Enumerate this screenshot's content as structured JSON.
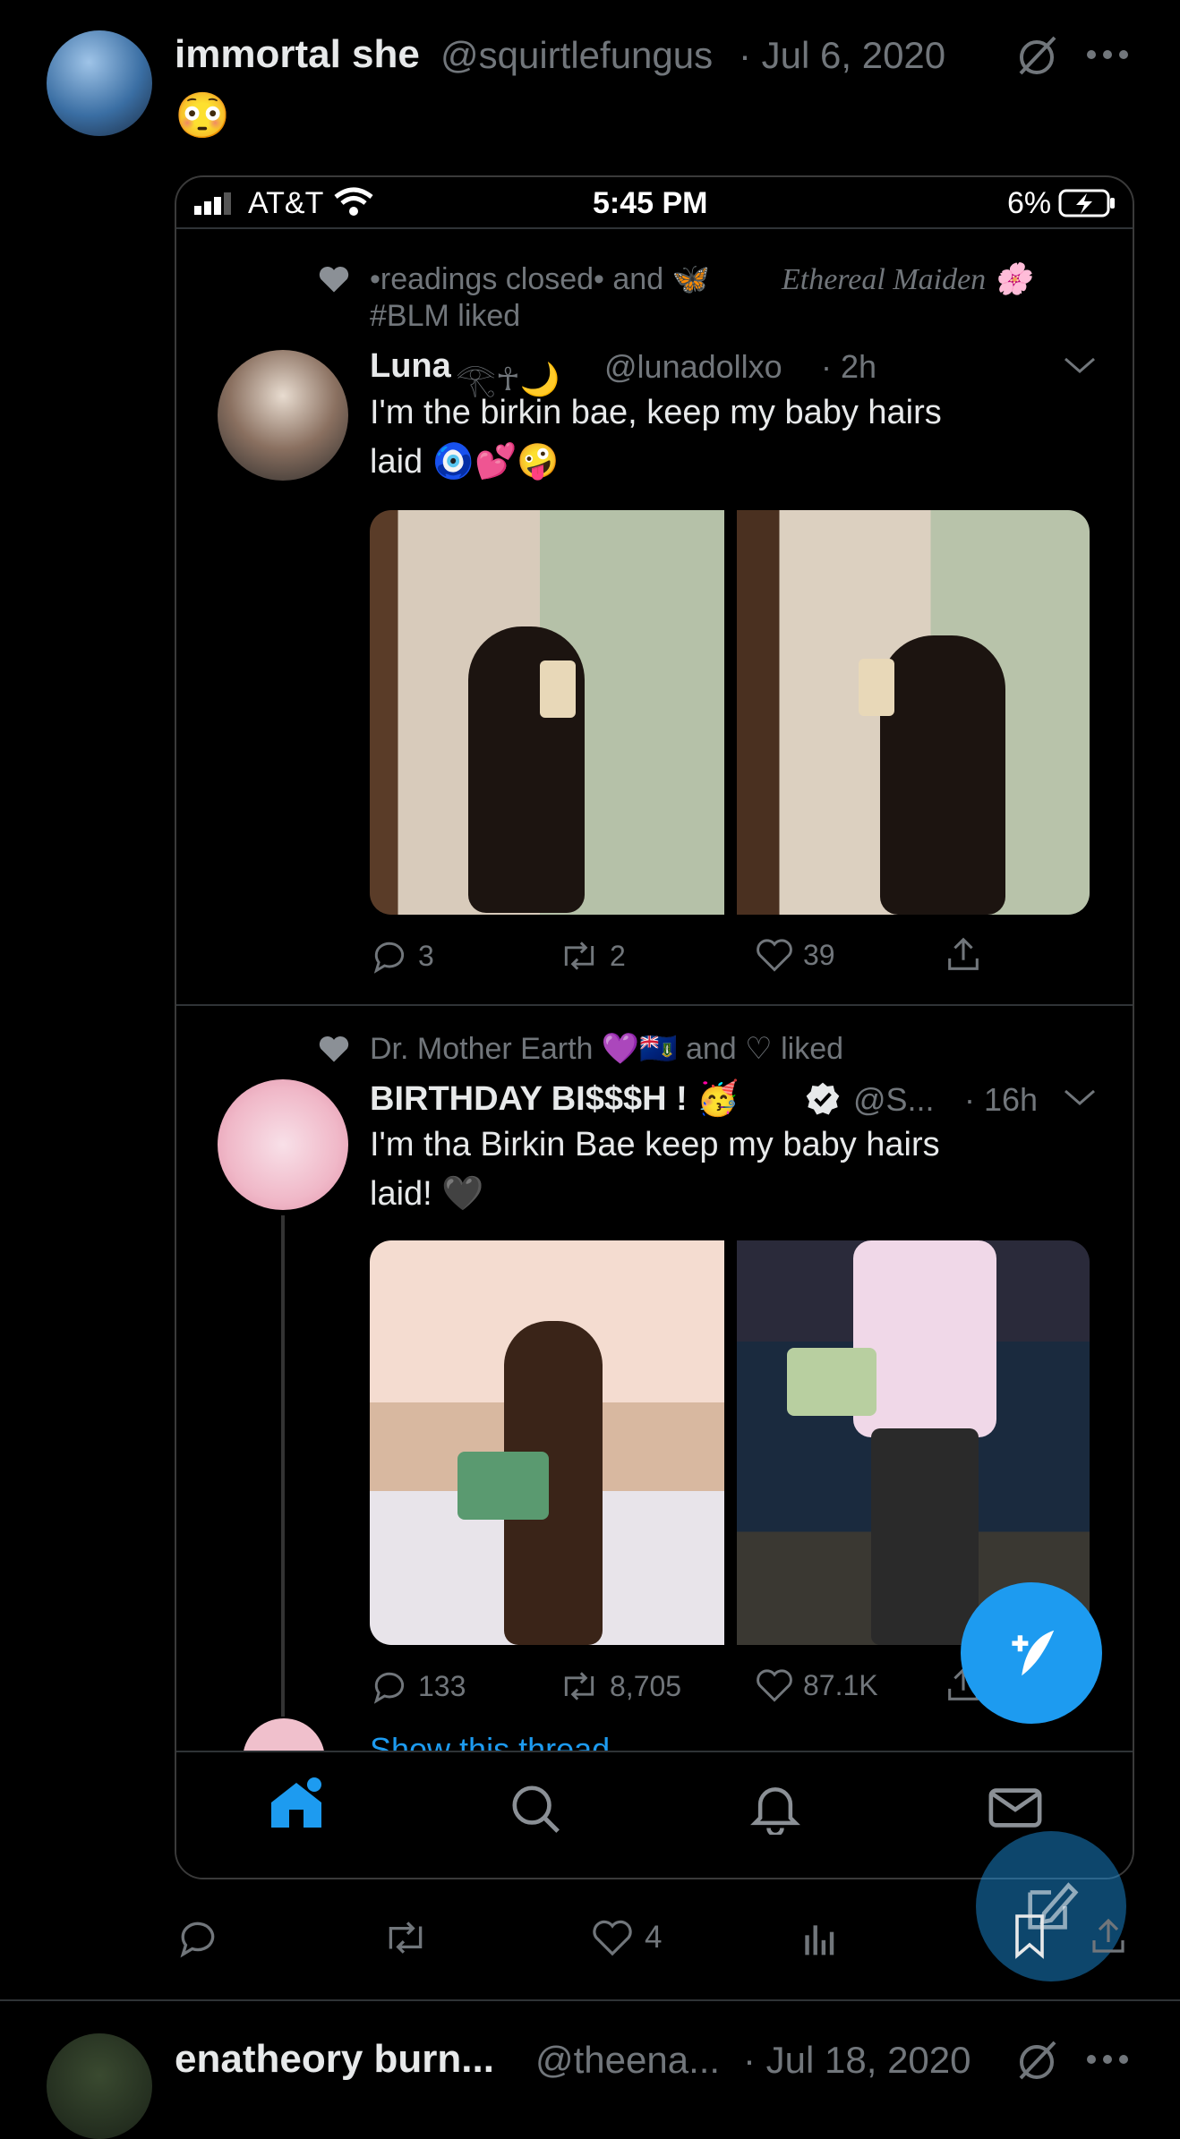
{
  "post": {
    "author_name": "immortal she",
    "handle": "@squirtlefungus",
    "date": "· Jul 6, 2020",
    "body_emoji": "😳"
  },
  "screenshot": {
    "status": {
      "carrier": "AT&T",
      "time": "5:45 PM",
      "battery": "6%"
    },
    "tweet1": {
      "social_context_a": "•readings closed• and 🦋",
      "social_context_b": "Ethereal Maiden 🌸",
      "social_context_c": "#BLM liked",
      "name": "Luna",
      "name_symbols": "𓂀☥🌙",
      "handle": "@lunadollxo",
      "time": "· 2h",
      "text_line1": "I'm the birkin bae, keep my baby hairs",
      "text_line2": "laid 🧿💕🤪",
      "replies": "3",
      "retweets": "2",
      "likes": "39"
    },
    "tweet2": {
      "social_context": "Dr. Mother Earth 💜🇻🇬 and ♡ liked",
      "name": "BIRTHDAY BI$$$H ! 🥳",
      "handle": "@S...",
      "time": "· 16h",
      "text_line1": "I'm tha Birkin Bae keep my baby hairs",
      "text_line2": "laid! 🖤",
      "replies": "133",
      "retweets": "8,705",
      "likes": "87.1K",
      "show_thread": "Show this thread"
    }
  },
  "actions": {
    "likes": "4"
  },
  "next_post": {
    "author_name": "enatheory burn...",
    "handle": "@theena...",
    "date": "· Jul 18, 2020"
  },
  "colors": {
    "accent": "#1d9bf0",
    "muted": "#71767b",
    "border": "#2f3336"
  }
}
